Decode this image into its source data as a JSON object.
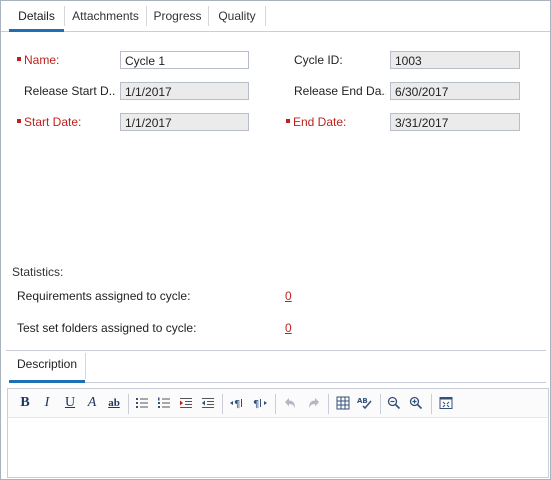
{
  "tabs": [
    {
      "label": "Details"
    },
    {
      "label": "Attachments"
    },
    {
      "label": "Progress"
    },
    {
      "label": "Quality"
    }
  ],
  "form": {
    "name_label": "Name:",
    "name_value": "Cycle 1",
    "cycle_id_label": "Cycle ID:",
    "cycle_id_value": "1003",
    "release_start_label": "Release Start D...",
    "release_start_value": "1/1/2017",
    "release_end_label": "Release End Da...",
    "release_end_value": "6/30/2017",
    "start_date_label": "Start Date:",
    "start_date_value": "1/1/2017",
    "end_date_label": "End Date:",
    "end_date_value": "3/31/2017"
  },
  "statistics": {
    "heading": "Statistics:",
    "requirements_label": "Requirements assigned to cycle:",
    "requirements_count": "0",
    "testset_label": "Test set folders assigned to cycle:",
    "testset_count": "0"
  },
  "description": {
    "tab_label": "Description",
    "toolbar": {
      "bold": "B",
      "italic": "I",
      "underline": "U",
      "font_color": "A",
      "highlight": "ab"
    }
  },
  "colors": {
    "required": "#c0211d",
    "accent": "#1f6fb5",
    "field_bg": "#ebebeb"
  }
}
